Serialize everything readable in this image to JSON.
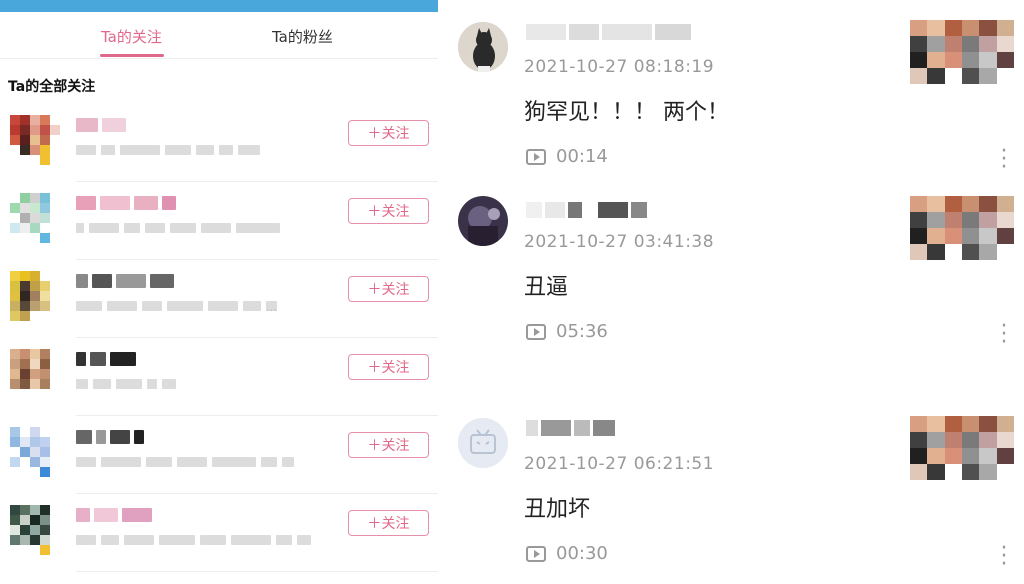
{
  "left_panel": {
    "tabs": [
      {
        "label": "Ta的关注",
        "active": true
      },
      {
        "label": "Ta的粉丝",
        "active": false
      }
    ],
    "section_title": "Ta的全部关注",
    "follow_button_label": "＋关注",
    "rows": [
      {
        "avatar_colors": [
          "#c9463a",
          "#a0302a",
          "#e8b0a0",
          "#d87a5a",
          "#ffffff",
          "#b83a30",
          "#7a2a24",
          "#e09a88",
          "#c0524a",
          "#f0d0c8",
          "#d05a40",
          "#5a2020",
          "#e8c090",
          "#c06a50",
          "#ffffff",
          "#ffffff",
          "#3a2a24",
          "#d89078",
          "#f0c030",
          "#ffffff",
          "#ffffff",
          "#ffffff",
          "#ffffff",
          "#f0c030",
          "#ffffff"
        ],
        "ellipsis": ""
      },
      {
        "avatar_colors": [
          "#ffffff",
          "#8fd0a0",
          "#d0d0d0",
          "#7ac0d8",
          "#ffffff",
          "#a0d8b0",
          "#e0e0e0",
          "#c8e8d0",
          "#90c8e0",
          "#ffffff",
          "#ffffff",
          "#b0b0b0",
          "#dadada",
          "#c0e0d8",
          "#ffffff",
          "#d0e8f0",
          "#eeeeee",
          "#a8d8c0",
          "#ffffff",
          "#ffffff",
          "#ffffff",
          "#ffffff",
          "#ffffff",
          "#60b8e0",
          "#ffffff"
        ],
        "ellipsis": ""
      },
      {
        "avatar_colors": [
          "#f0d040",
          "#e8c020",
          "#d8b030",
          "#ffffff",
          "#ffffff",
          "#d8c040",
          "#4a3a30",
          "#c0a048",
          "#e8d070",
          "#ffffff",
          "#e0c040",
          "#302820",
          "#a08060",
          "#f0e0a0",
          "#ffffff",
          "#c8b060",
          "#584838",
          "#b8a070",
          "#d8c080",
          "#ffffff",
          "#e0c860",
          "#c0a050",
          "#ffffff",
          "#ffffff",
          "#ffffff"
        ],
        "ellipsis": "…"
      },
      {
        "avatar_colors": [
          "#d8b090",
          "#c89070",
          "#e8c8a0",
          "#b08060",
          "#ffffff",
          "#c8a080",
          "#a07050",
          "#f0d8c0",
          "#8a6040",
          "#ffffff",
          "#e0b890",
          "#6a4030",
          "#d0a080",
          "#c09070",
          "#ffffff",
          "#b89070",
          "#805a40",
          "#e8c8a8",
          "#a88060",
          "#ffffff",
          "#ffffff",
          "#ffffff",
          "#ffffff",
          "#ffffff",
          "#ffffff"
        ],
        "ellipsis": ""
      },
      {
        "avatar_colors": [
          "#a8c8e8",
          "#ffffff",
          "#d0d8f0",
          "#ffffff",
          "#ffffff",
          "#90b8e0",
          "#e0e8f8",
          "#b0c8e8",
          "#c0d0f0",
          "#ffffff",
          "#ffffff",
          "#7aa8d8",
          "#d8e0f0",
          "#a8c0e8",
          "#ffffff",
          "#c0d8f0",
          "#ffffff",
          "#98b8e0",
          "#e8eef8",
          "#ffffff",
          "#ffffff",
          "#ffffff",
          "#ffffff",
          "#3a8ad8",
          "#ffffff"
        ],
        "ellipsis": ""
      },
      {
        "avatar_colors": [
          "#304840",
          "#5a7060",
          "#a0b8b0",
          "#203028",
          "#ffffff",
          "#405848",
          "#c8d0c8",
          "#182820",
          "#7a9088",
          "#ffffff",
          "#e0e8e0",
          "#2a4038",
          "#90a8a0",
          "#384840",
          "#ffffff",
          "#607870",
          "#a8b8b0",
          "#283830",
          "#d0d8d0",
          "#ffffff",
          "#ffffff",
          "#ffffff",
          "#ffffff",
          "#f0c030",
          "#ffffff"
        ],
        "ellipsis": ""
      }
    ]
  },
  "right_panel": {
    "posts": [
      {
        "timestamp": "2021-10-27 08:18:19",
        "text": "狗罕见！！！ 两个！",
        "duration": "00:14"
      },
      {
        "timestamp": "2021-10-27 03:41:38",
        "text": "丑逼",
        "duration": "05:36"
      },
      {
        "timestamp": "2021-10-27 06:21:51",
        "text": "丑加坏",
        "duration": "00:30"
      }
    ],
    "thumb_colors": [
      "#d8a080",
      "#e8c0a0",
      "#b06040",
      "#c89070",
      "#8a5040",
      "#d0b090",
      "#404040",
      "#a0a0a0",
      "#c08070",
      "#7a7a7a",
      "#c0a0a0",
      "#e8d8d0",
      "#202020",
      "#e0b090",
      "#d89078",
      "#909090",
      "#c8c8c8",
      "#604040",
      "#e0c8b8",
      "#383838",
      "#ffffff",
      "#505050",
      "#a8a8a8",
      "#ffffff"
    ]
  },
  "colors": {
    "accent_pink": "#e0688a",
    "top_bar_blue": "#4aa7dc",
    "meta_gray": "#999999"
  }
}
